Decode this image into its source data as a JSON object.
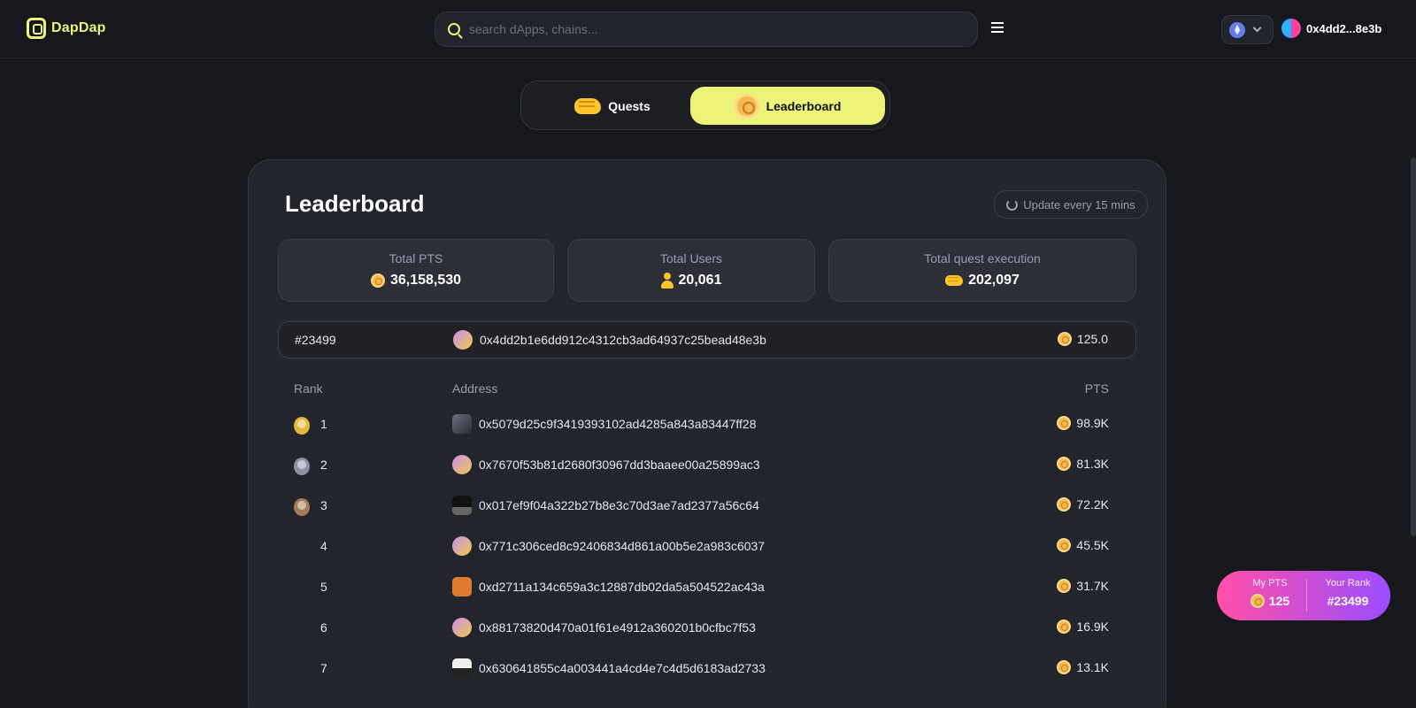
{
  "header": {
    "logo_text": "DapDap",
    "search_placeholder": "search dApps, chains...",
    "wallet_address": "0x4dd2...8e3b",
    "chain_icon": "ethereum-icon"
  },
  "tabs": [
    {
      "label": "Quests",
      "icon": "fist-icon",
      "active": false
    },
    {
      "label": "Leaderboard",
      "icon": "coin-icon",
      "active": true
    }
  ],
  "leaderboard": {
    "title": "Leaderboard",
    "update_label": "Update every 15 mins",
    "stats": [
      {
        "label": "Total PTS",
        "value": "36,158,530",
        "icon": "coin-icon"
      },
      {
        "label": "Total Users",
        "value": "20,061",
        "icon": "user-icon"
      },
      {
        "label": "Total quest execution",
        "value": "202,097",
        "icon": "fist-icon"
      }
    ],
    "my_row": {
      "rank": "#23499",
      "address": "0x4dd2b1e6dd912c4312cb3ad64937c25bead48e3b",
      "pts": "125.0"
    },
    "columns": {
      "rank": "Rank",
      "address": "Address",
      "pts": "PTS"
    },
    "rows": [
      {
        "rank": "1",
        "address": "0x5079d25c9f3419393102ad4285a843a83447ff28",
        "pts": "98.9K",
        "medal": "gold"
      },
      {
        "rank": "2",
        "address": "0x7670f53b81d2680f30967dd3baaee00a25899ac3",
        "pts": "81.3K",
        "medal": "silver"
      },
      {
        "rank": "3",
        "address": "0x017ef9f04a322b27b8e3c70d3ae7ad2377a56c64",
        "pts": "72.2K",
        "medal": "bronze"
      },
      {
        "rank": "4",
        "address": "0x771c306ced8c92406834d861a00b5e2a983c6037",
        "pts": "45.5K"
      },
      {
        "rank": "5",
        "address": "0xd2711a134c659a3c12887db02da5a504522ac43a",
        "pts": "31.7K"
      },
      {
        "rank": "6",
        "address": "0x88173820d470a01f61e4912a360201b0cfbc7f53",
        "pts": "16.9K"
      },
      {
        "rank": "7",
        "address": "0x630641855c4a003441a4cd4e7c4d5d6183ad2733",
        "pts": "13.1K"
      }
    ]
  },
  "my_pts_widget": {
    "pts_label": "My PTS",
    "pts_value": "125",
    "rank_label": "Your Rank",
    "rank_value": "#23499"
  },
  "colors": {
    "accent": "#ebf479",
    "background": "#16181d",
    "card": "#23252c",
    "widget_gradient_start": "#ff4fa7",
    "widget_gradient_end": "#9b4dff"
  }
}
